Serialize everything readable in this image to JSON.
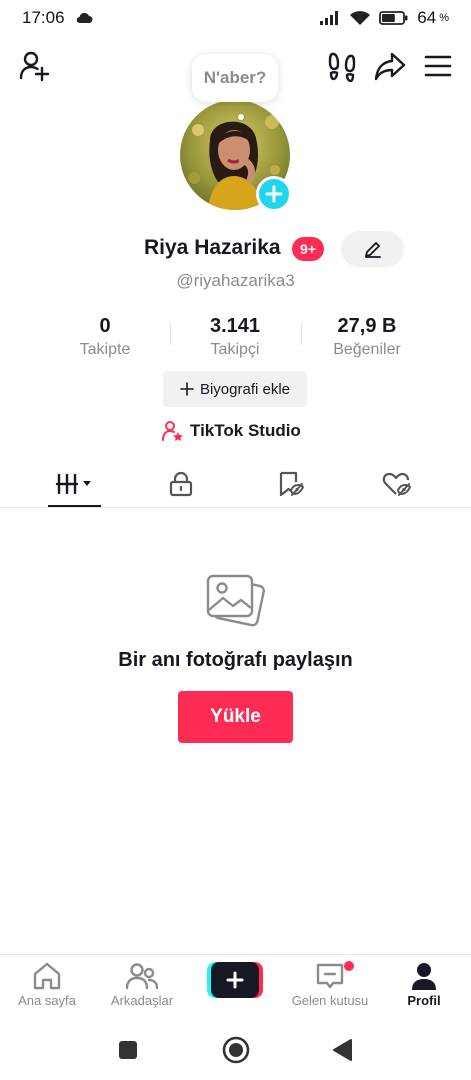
{
  "status_bar": {
    "time": "17:06",
    "battery_percent": "64",
    "battery_sign": "%",
    "battery_level": 0.64,
    "icons": [
      "cloud-icon",
      "signal-icon",
      "wifi-icon",
      "battery-icon"
    ]
  },
  "top_bar": {
    "icons": [
      "add-friend-icon",
      "footprints-icon",
      "share-icon",
      "menu-icon"
    ]
  },
  "profile": {
    "note": "N'aber?",
    "display_name": "Riya Hazarika",
    "badge": "9+",
    "username": "@riyahazarika3",
    "bio_button": "Biyografi ekle",
    "studio_label": "TikTok Studio"
  },
  "stats": [
    {
      "value": "0",
      "label": "Takipte"
    },
    {
      "value": "3.141",
      "label": "Takipçi"
    },
    {
      "value": "27,9 B",
      "label": "Beğeniler"
    }
  ],
  "tabs": [
    "videos-tab",
    "private-tab",
    "saved-tab",
    "liked-tab"
  ],
  "empty_state": {
    "title": "Bir anı fotoğrafı paylaşın",
    "button": "Yükle"
  },
  "bottom_nav": {
    "items": [
      {
        "label": "Ana sayfa",
        "icon": "home-icon"
      },
      {
        "label": "Arkadaşlar",
        "icon": "friends-icon"
      },
      {
        "label": "",
        "icon": "plus-icon"
      },
      {
        "label": "Gelen kutusu",
        "icon": "inbox-icon"
      },
      {
        "label": "Profil",
        "icon": "profile-icon"
      }
    ],
    "active": "Profil"
  },
  "colors": {
    "accent": "#fe2c55",
    "cyan": "#20d5ec",
    "text": "#161823",
    "muted": "#8a8b91"
  }
}
